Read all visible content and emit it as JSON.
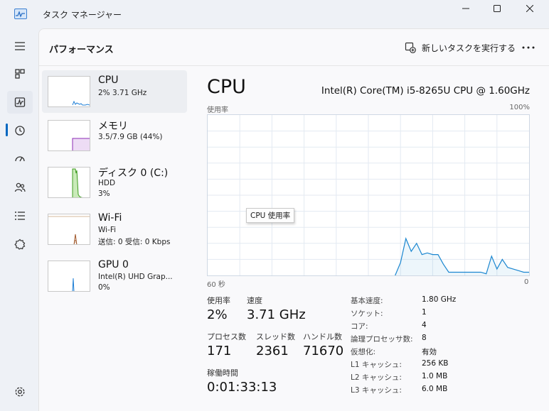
{
  "window": {
    "title": "タスク マネージャー",
    "app_icon": "task-manager-icon"
  },
  "nav_rail": {
    "items": [
      {
        "name": "hamburger-icon"
      },
      {
        "name": "processes-icon"
      },
      {
        "name": "performance-icon",
        "active": true
      },
      {
        "name": "app-history-icon"
      },
      {
        "name": "startup-apps-icon"
      },
      {
        "name": "users-icon"
      },
      {
        "name": "details-icon"
      },
      {
        "name": "services-icon"
      }
    ],
    "settings_icon": "settings-icon"
  },
  "header": {
    "title": "パフォーマンス",
    "run_task_label": "新しいタスクを実行する",
    "more_icon": "more-icon"
  },
  "perf_items": [
    {
      "name": "CPU",
      "sub1": "2%  3.71 GHz",
      "selected": true,
      "color": "#1f7fd6"
    },
    {
      "name": "メモリ",
      "sub1": "3.5/7.9 GB (44%)",
      "color": "#8c2bb5"
    },
    {
      "name": "ディスク 0 (C:)",
      "sub1": "HDD",
      "sub2": "3%",
      "color": "#3d9b1f"
    },
    {
      "name": "Wi-Fi",
      "sub1": "Wi-Fi",
      "sub2": "送信: 0 受信: 0 Kbps",
      "color": "#a0582a"
    },
    {
      "name": "GPU 0",
      "sub1": "Intel(R) UHD Grap...",
      "sub2": "0%",
      "color": "#1f7fd6"
    }
  ],
  "detail": {
    "title": "CPU",
    "model": "Intel(R) Core(TM) i5-8265U CPU @ 1.60GHz",
    "y_label": "使用率",
    "y_max_label": "100%",
    "x_left_label": "60 秒",
    "x_right_label": "0",
    "tooltip": "CPU 使用率",
    "accent": "#1a86d0",
    "stats": {
      "usage_label": "使用率",
      "usage_value": "2%",
      "speed_label": "速度",
      "speed_value": "3.71 GHz",
      "processes_label": "プロセス数",
      "processes_value": "171",
      "threads_label": "スレッド数",
      "threads_value": "2361",
      "handles_label": "ハンドル数",
      "handles_value": "71670",
      "uptime_label": "稼働時間",
      "uptime_value": "0:01:33:13"
    },
    "info": [
      {
        "key": "基本速度:",
        "value": "1.80 GHz"
      },
      {
        "key": "ソケット:",
        "value": "1"
      },
      {
        "key": "コア:",
        "value": "4"
      },
      {
        "key": "論理プロセッサ数:",
        "value": "8"
      },
      {
        "key": "仮想化:",
        "value": "有効"
      },
      {
        "key": "L1 キャッシュ:",
        "value": "256 KB"
      },
      {
        "key": "L2 キャッシュ:",
        "value": "1.0 MB"
      },
      {
        "key": "L3 キャッシュ:",
        "value": "6.0 MB"
      }
    ]
  },
  "chart_data": {
    "type": "area",
    "x": [
      60,
      59,
      58,
      57,
      56,
      55,
      54,
      53,
      52,
      51,
      50,
      49,
      48,
      47,
      46,
      45,
      44,
      43,
      42,
      41,
      40,
      39,
      38,
      37,
      36,
      35,
      34,
      33,
      32,
      31,
      30,
      29,
      28,
      27,
      26,
      25,
      24,
      23,
      22,
      21,
      20,
      19,
      18,
      17,
      16,
      15,
      14,
      13,
      12,
      11,
      10,
      9,
      8,
      7,
      6,
      5,
      4,
      3,
      2,
      1,
      0
    ],
    "series": [
      {
        "values": [
          null,
          null,
          null,
          null,
          null,
          null,
          null,
          null,
          null,
          null,
          null,
          null,
          null,
          null,
          null,
          null,
          null,
          null,
          null,
          null,
          null,
          null,
          null,
          null,
          null,
          null,
          null,
          null,
          null,
          null,
          null,
          null,
          null,
          null,
          null,
          0,
          8,
          23,
          15,
          20,
          13,
          14,
          13,
          13,
          7,
          2,
          2,
          2,
          2,
          2,
          2,
          2,
          1,
          12,
          4,
          10,
          5,
          4,
          3,
          2,
          2
        ]
      }
    ],
    "xlabel": "",
    "ylabel": "使用率",
    "xlim": [
      60,
      0
    ],
    "ylim": [
      0,
      100
    ],
    "grid": true
  }
}
